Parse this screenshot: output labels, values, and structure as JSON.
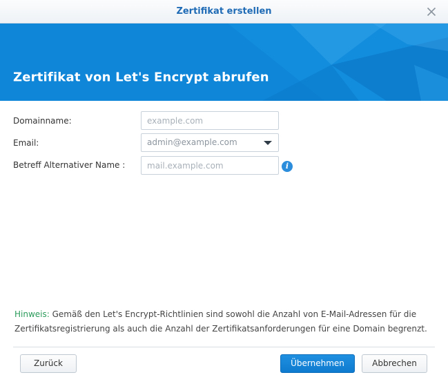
{
  "window": {
    "title": "Zertifikat erstellen"
  },
  "banner": {
    "heading": "Zertifikat von Let's Encrypt abrufen"
  },
  "form": {
    "domain": {
      "label": "Domainname:",
      "placeholder": "example.com",
      "value": ""
    },
    "email": {
      "label": "Email:",
      "value": "admin@example.com"
    },
    "san": {
      "label": "Betreff Alternativer Name :",
      "placeholder": "mail.example.com",
      "value": ""
    }
  },
  "note": {
    "hint_label": "Hinweis:",
    "text": " Gemäß den Let's Encrypt-Richtlinien sind sowohl die Anzahl von E-Mail-Adressen für die Zertifikatsregistrierung als auch die Anzahl der Zertifikatsanforderungen für eine Domain begrenzt."
  },
  "buttons": {
    "back": "Zurück",
    "apply": "Übernehmen",
    "cancel": "Abbrechen"
  },
  "icons": {
    "close": "close-icon",
    "info": "info-icon",
    "dropdown": "chevron-down-icon"
  },
  "colors": {
    "title": "#1f6bb5",
    "banner": "#0f85d6",
    "hint": "#2a9b5a",
    "primary_button": "#1585d8"
  }
}
